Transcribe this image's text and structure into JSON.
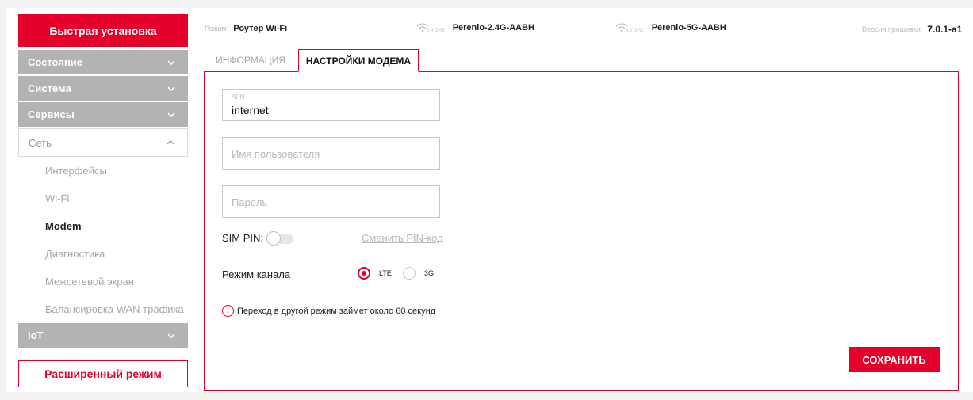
{
  "sidebar": {
    "quick_setup": "Быстрая установка",
    "items": [
      {
        "label": "Состояние",
        "icon": "chevron-down-icon"
      },
      {
        "label": "Система",
        "icon": "chevron-down-icon"
      },
      {
        "label": "Сервисы",
        "icon": "chevron-down-icon"
      },
      {
        "label": "Сеть",
        "icon": "chevron-up-icon"
      },
      {
        "label": "IoT",
        "icon": "chevron-down-icon"
      }
    ],
    "network_sub": [
      "Интерфейсы",
      "Wi-Fi",
      "Modem",
      "Диагностика",
      "Межсетевой экран",
      "Балансировка WAN трафика"
    ],
    "active_sub": "Modem",
    "advanced_mode": "Расширенный режим"
  },
  "header": {
    "mode_label": "Режим:",
    "mode_value": "Роутер Wi-Fi",
    "wifi24_band": "2.4 GHZ",
    "wifi24_ssid": "Perenio-2.4G-AABH",
    "wifi5_band": "5.0 GHZ",
    "wifi5_ssid": "Perenio-5G-AABH",
    "fw_label": "Версия прошивки:",
    "fw_value": "7.0.1-a1"
  },
  "tabs": {
    "info": "ИНФОРМАЦИЯ",
    "modem": "НАСТРОЙКИ МОДЕМА"
  },
  "form": {
    "apn_label": "APN",
    "apn_value": "internet",
    "user_placeholder": "Имя пользователя",
    "pass_placeholder": "Пароль",
    "sim_pin_label": "SIM PIN:",
    "sim_pin_enabled": false,
    "change_pin": "Сменить PIN-код",
    "channel_mode_label": "Режим канала",
    "mode_lte": "LTE",
    "mode_3g": "3G",
    "selected_mode": "LTE",
    "notice": "Переход в другой режим займет около 60 секунд",
    "save": "СОХРАНИТЬ"
  },
  "colors": {
    "accent": "#e4002b",
    "menu_bg": "#b3b3b3"
  }
}
